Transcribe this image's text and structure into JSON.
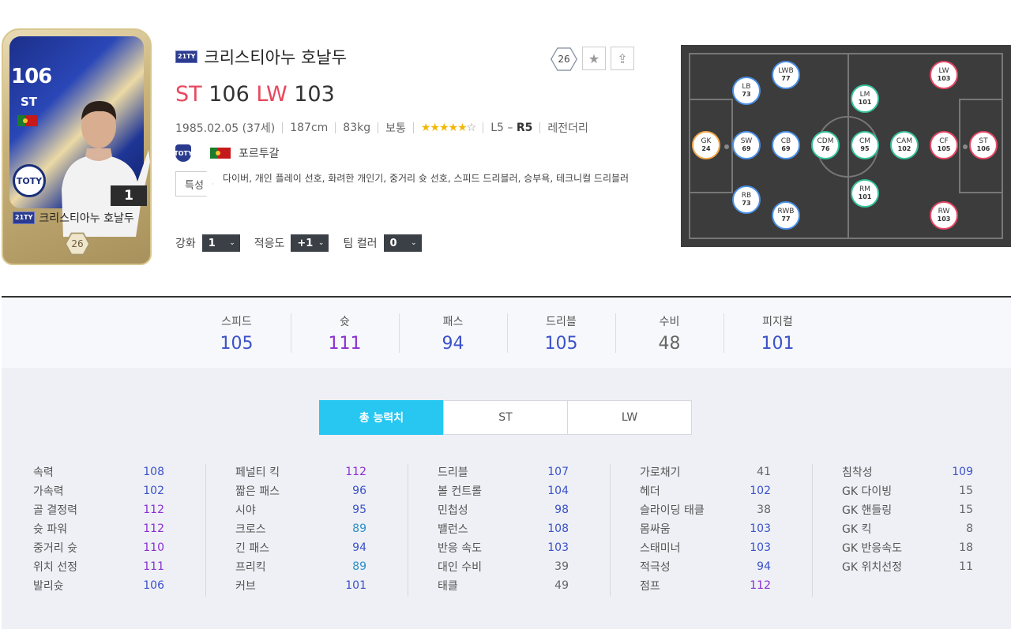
{
  "card": {
    "ovr": "106",
    "position": "ST",
    "badge": "TOTY",
    "level": "1",
    "season": "21TY",
    "name": "크리스티아누 호날두",
    "pay": "26"
  },
  "player": {
    "season": "21TY",
    "name": "크리스티아누 호날두",
    "pos1": "ST",
    "ovr1": "106",
    "pos2": "LW",
    "ovr2": "103",
    "birth": "1985.02.05 (37세)",
    "height": "187cm",
    "weight": "83kg",
    "body": "보통",
    "stars_on": "★★★★★",
    "stars_off": "☆",
    "foot_left": "L5 –",
    "foot_right": "R5",
    "class": "레전더리",
    "club_icon": "TOTY",
    "nation": "포르투갈",
    "trait_label": "특성",
    "traits": "다이버, 개인 플레이 선호, 화려한 개인기, 중거리 슛 선호, 스피드 드리블러, 승부욕, 테크니컬 드리블러"
  },
  "actions": {
    "pay": "26",
    "star": "★",
    "upgrade": "⇪"
  },
  "controls": {
    "enhance_label": "강화",
    "enhance_value": "1",
    "adapt_label": "적응도",
    "adapt_value": "+1",
    "teamcolor_label": "팀 컬러",
    "teamcolor_value": "0",
    "chev": "⌄"
  },
  "positions": [
    {
      "pos": "GK",
      "val": "24",
      "kind": "gk"
    },
    {
      "pos": "LB",
      "val": "73",
      "kind": "def"
    },
    {
      "pos": "SW",
      "val": "69",
      "kind": "def"
    },
    {
      "pos": "RB",
      "val": "73",
      "kind": "def"
    },
    {
      "pos": "LWB",
      "val": "77",
      "kind": "def"
    },
    {
      "pos": "CB",
      "val": "69",
      "kind": "def"
    },
    {
      "pos": "RWB",
      "val": "77",
      "kind": "def"
    },
    {
      "pos": "CDM",
      "val": "76",
      "kind": "mid"
    },
    {
      "pos": "LM",
      "val": "101",
      "kind": "mid"
    },
    {
      "pos": "CM",
      "val": "95",
      "kind": "mid"
    },
    {
      "pos": "RM",
      "val": "101",
      "kind": "mid"
    },
    {
      "pos": "CAM",
      "val": "102",
      "kind": "mid"
    },
    {
      "pos": "LW",
      "val": "103",
      "kind": "fwd"
    },
    {
      "pos": "CF",
      "val": "105",
      "kind": "fwd"
    },
    {
      "pos": "RW",
      "val": "103",
      "kind": "fwd"
    },
    {
      "pos": "ST",
      "val": "106",
      "kind": "fwd"
    }
  ],
  "summary": [
    {
      "label": "스피드",
      "value": "105",
      "color": "#3b51c9"
    },
    {
      "label": "슛",
      "value": "111",
      "color": "#8a2fd1"
    },
    {
      "label": "패스",
      "value": "94",
      "color": "#3b51c9"
    },
    {
      "label": "드리블",
      "value": "105",
      "color": "#3b51c9"
    },
    {
      "label": "수비",
      "value": "48",
      "color": "#666666"
    },
    {
      "label": "피지컬",
      "value": "101",
      "color": "#3b51c9"
    }
  ],
  "tabs": [
    "총 능력치",
    "ST",
    "LW"
  ],
  "stats": [
    [
      {
        "n": "속력",
        "v": "108",
        "c": "#3b51c9"
      },
      {
        "n": "가속력",
        "v": "102",
        "c": "#3b51c9"
      },
      {
        "n": "골 결정력",
        "v": "112",
        "c": "#8a2fd1"
      },
      {
        "n": "슛 파워",
        "v": "112",
        "c": "#8a2fd1"
      },
      {
        "n": "중거리 슛",
        "v": "110",
        "c": "#8a2fd1"
      },
      {
        "n": "위치 선정",
        "v": "111",
        "c": "#8a2fd1"
      },
      {
        "n": "발리슛",
        "v": "106",
        "c": "#3b51c9"
      }
    ],
    [
      {
        "n": "페널티 킥",
        "v": "112",
        "c": "#8a2fd1"
      },
      {
        "n": "짧은 패스",
        "v": "96",
        "c": "#3b51c9"
      },
      {
        "n": "시야",
        "v": "95",
        "c": "#3b51c9"
      },
      {
        "n": "크로스",
        "v": "89",
        "c": "#2a8fc9"
      },
      {
        "n": "긴 패스",
        "v": "94",
        "c": "#3b51c9"
      },
      {
        "n": "프리킥",
        "v": "89",
        "c": "#2a8fc9"
      },
      {
        "n": "커브",
        "v": "101",
        "c": "#3b51c9"
      }
    ],
    [
      {
        "n": "드리블",
        "v": "107",
        "c": "#3b51c9"
      },
      {
        "n": "볼 컨트롤",
        "v": "104",
        "c": "#3b51c9"
      },
      {
        "n": "민첩성",
        "v": "98",
        "c": "#3b51c9"
      },
      {
        "n": "밸런스",
        "v": "108",
        "c": "#3b51c9"
      },
      {
        "n": "반응 속도",
        "v": "103",
        "c": "#3b51c9"
      },
      {
        "n": "대인 수비",
        "v": "39",
        "c": "#666666"
      },
      {
        "n": "태클",
        "v": "49",
        "c": "#666666"
      }
    ],
    [
      {
        "n": "가로채기",
        "v": "41",
        "c": "#666666"
      },
      {
        "n": "헤더",
        "v": "102",
        "c": "#3b51c9"
      },
      {
        "n": "슬라이딩 태클",
        "v": "38",
        "c": "#666666"
      },
      {
        "n": "몸싸움",
        "v": "103",
        "c": "#3b51c9"
      },
      {
        "n": "스태미너",
        "v": "103",
        "c": "#3b51c9"
      },
      {
        "n": "적극성",
        "v": "94",
        "c": "#3b51c9"
      },
      {
        "n": "점프",
        "v": "112",
        "c": "#8a2fd1"
      }
    ],
    [
      {
        "n": "침착성",
        "v": "109",
        "c": "#3b51c9"
      },
      {
        "n": "GK 다이빙",
        "v": "15",
        "c": "#666666"
      },
      {
        "n": "GK 핸들링",
        "v": "15",
        "c": "#666666"
      },
      {
        "n": "GK 킥",
        "v": "8",
        "c": "#666666"
      },
      {
        "n": "GK 반응속도",
        "v": "18",
        "c": "#666666"
      },
      {
        "n": "GK 위치선정",
        "v": "11",
        "c": "#666666"
      }
    ]
  ]
}
